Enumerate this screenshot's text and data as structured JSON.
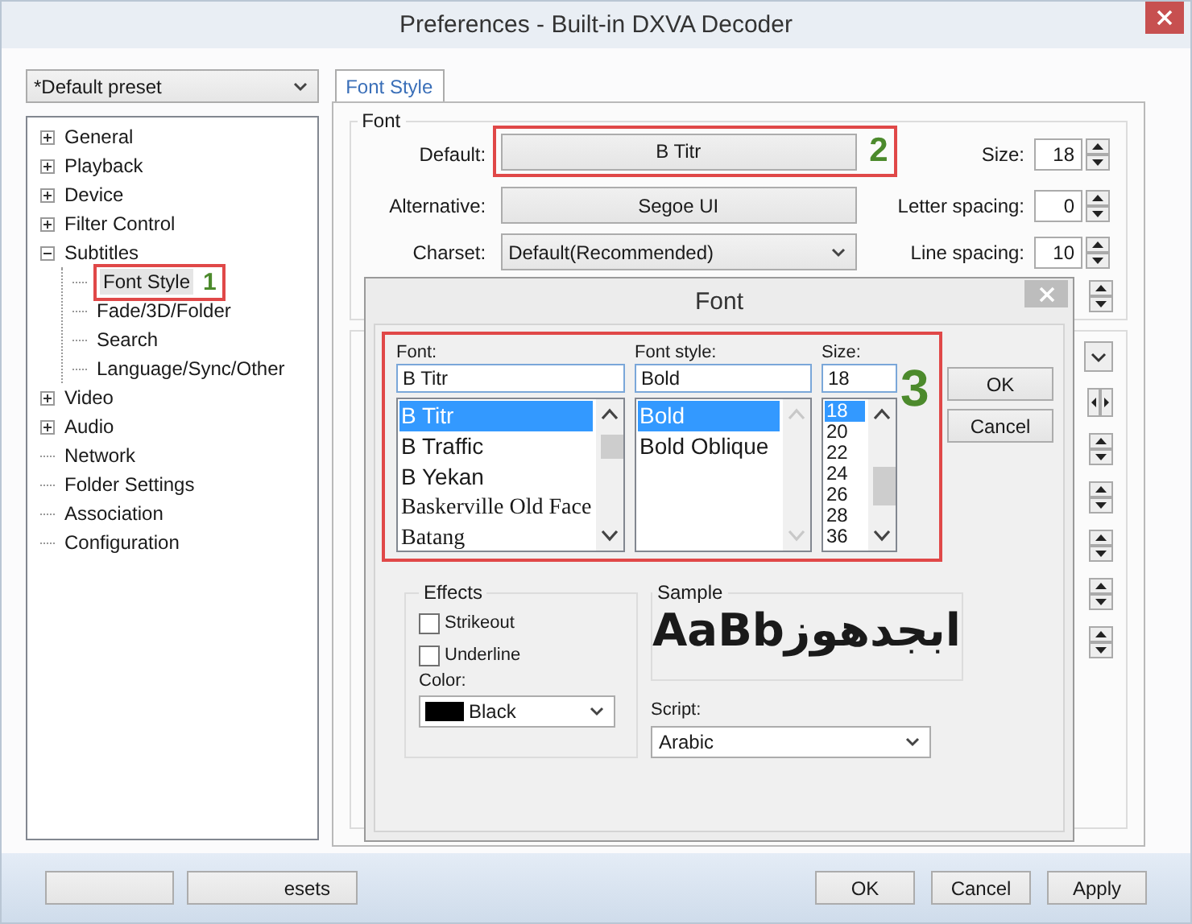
{
  "window": {
    "title": "Preferences - Built-in DXVA Decoder"
  },
  "preset": {
    "value": "*Default preset"
  },
  "tree": [
    {
      "label": "General",
      "kind": "group",
      "expanded": false,
      "selected": false
    },
    {
      "label": "Playback",
      "kind": "group",
      "expanded": false,
      "selected": false
    },
    {
      "label": "Device",
      "kind": "group",
      "expanded": false,
      "selected": false
    },
    {
      "label": "Filter Control",
      "kind": "group",
      "expanded": false,
      "selected": false
    },
    {
      "label": "Subtitles",
      "kind": "group",
      "expanded": true,
      "selected": false,
      "children": [
        {
          "label": "Font Style",
          "kind": "leaf",
          "selected": true,
          "annotation": "1"
        },
        {
          "label": "Fade/3D/Folder",
          "kind": "leaf",
          "selected": false
        },
        {
          "label": "Search",
          "kind": "leaf",
          "selected": false
        },
        {
          "label": "Language/Sync/Other",
          "kind": "leaf",
          "selected": false
        }
      ]
    },
    {
      "label": "Video",
      "kind": "group",
      "expanded": false,
      "selected": false
    },
    {
      "label": "Audio",
      "kind": "group",
      "expanded": false,
      "selected": false
    },
    {
      "label": "Network",
      "kind": "leaf",
      "selected": false
    },
    {
      "label": "Folder Settings",
      "kind": "leaf",
      "selected": false
    },
    {
      "label": "Association",
      "kind": "leaf",
      "selected": false
    },
    {
      "label": "Configuration",
      "kind": "leaf",
      "selected": false
    }
  ],
  "tabs": [
    {
      "label": "Font Style",
      "selected": true
    }
  ],
  "font_group": {
    "title": "Font",
    "annotation": "2",
    "fields": [
      {
        "label": "Default:",
        "kind": "button",
        "value": "B Titr"
      },
      {
        "label": "Alternative:",
        "kind": "button",
        "value": "Segoe UI"
      },
      {
        "label": "Charset:",
        "kind": "dropdown",
        "value": "Default(Recommended)"
      }
    ],
    "spinners": [
      {
        "label": "Size:",
        "value": "18"
      },
      {
        "label": "Letter spacing:",
        "value": "0"
      },
      {
        "label": "Line spacing:",
        "value": "10"
      }
    ]
  },
  "font_dialog": {
    "title": "Font",
    "annotation": "3",
    "columns": [
      {
        "kind": "family",
        "label": "Font:",
        "value": "B Titr",
        "items": [
          {
            "text": "B Titr",
            "kind": "sans",
            "selected": true
          },
          {
            "text": "B Traffic",
            "kind": "sans",
            "selected": false
          },
          {
            "text": "B Yekan",
            "kind": "sans",
            "selected": false
          },
          {
            "text": "Baskerville Old Face",
            "kind": "serif",
            "selected": false
          },
          {
            "text": "Batang",
            "kind": "serif",
            "selected": false
          }
        ]
      },
      {
        "kind": "style",
        "label": "Font style:",
        "value": "Bold",
        "items": [
          {
            "text": "Bold",
            "kind": "sans",
            "selected": true
          },
          {
            "text": "Bold Oblique",
            "kind": "sans",
            "selected": false
          }
        ]
      },
      {
        "kind": "size",
        "label": "Size:",
        "value": "18",
        "items": [
          {
            "text": "18",
            "kind": "small",
            "selected": true
          },
          {
            "text": "20",
            "kind": "small",
            "selected": false
          },
          {
            "text": "22",
            "kind": "small",
            "selected": false
          },
          {
            "text": "24",
            "kind": "small",
            "selected": false
          },
          {
            "text": "26",
            "kind": "small",
            "selected": false
          },
          {
            "text": "28",
            "kind": "small",
            "selected": false
          },
          {
            "text": "36",
            "kind": "small",
            "selected": false
          }
        ]
      }
    ],
    "buttons": [
      "OK",
      "Cancel"
    ],
    "effects": {
      "title": "Effects",
      "options": [
        {
          "label": "Strikeout",
          "checked": false
        },
        {
          "label": "Underline",
          "checked": false
        }
      ],
      "color_label": "Color:",
      "color_value": "Black",
      "color": "#000000"
    },
    "sample": {
      "title": "Sample",
      "text": "AaBbابجدهوز"
    },
    "script": {
      "label": "Script:",
      "value": "Arabic"
    }
  },
  "footer": {
    "left_buttons": [
      {
        "kind": "covered"
      },
      {
        "kind": "text",
        "label": "esets"
      }
    ],
    "buttons": [
      "OK",
      "Cancel",
      "Apply"
    ]
  }
}
